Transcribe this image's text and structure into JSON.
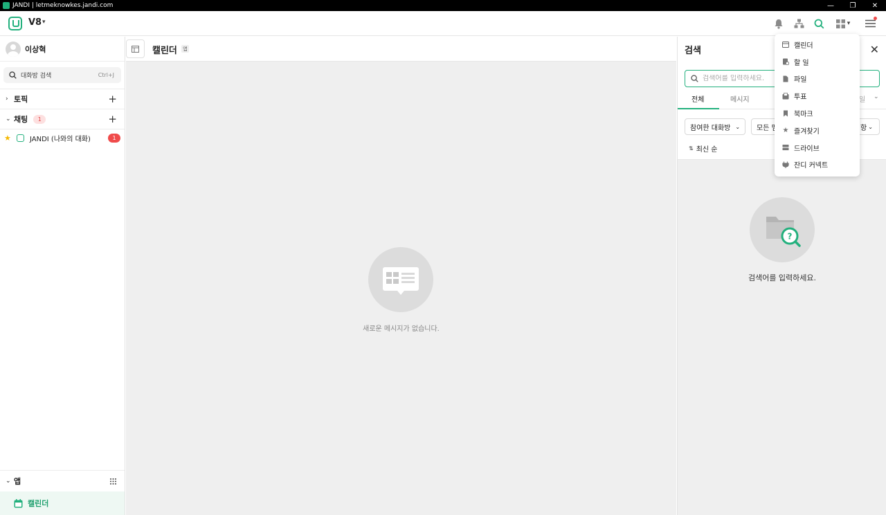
{
  "window": {
    "title": "JANDI | letmeknowkes.jandi.com",
    "controls": [
      "—",
      "❐",
      "✕"
    ]
  },
  "header": {
    "team_name": "V8",
    "caret": "⌄",
    "icons": [
      "bell-icon",
      "org-chart-icon",
      "search-icon",
      "apps-grid-icon",
      "menu-icon"
    ],
    "accent_color": "#22b07d"
  },
  "sidebar": {
    "profile_name": "이상혁",
    "search": {
      "label": "대화방 검색",
      "shortcut": "Ctrl+J"
    },
    "sections": {
      "topic": {
        "label": "토픽"
      },
      "chat": {
        "label": "채팅",
        "badge": "1"
      },
      "apps": {
        "label": "앱"
      }
    },
    "chats": [
      {
        "name": "JANDI (나와의 대화)",
        "badge": "1"
      }
    ],
    "apps_items": [
      {
        "label": "캘린더"
      }
    ]
  },
  "center": {
    "title": "캘린더",
    "tag": "앱",
    "empty_message": "새로운 메시지가 없습니다."
  },
  "search_panel": {
    "title": "검색",
    "placeholder": "검색어를 입력하세요.",
    "tabs": [
      {
        "label": "전체",
        "active": true
      },
      {
        "label": "메시지",
        "active": false
      }
    ],
    "tab_more": "일",
    "filters": [
      {
        "label": "참여한 대화방"
      },
      {
        "label": "모든 멤"
      },
      {
        "label": "항"
      }
    ],
    "sort_label": "최신 순",
    "empty_message": "검색어를 입력하세요."
  },
  "apps_dropdown": {
    "items": [
      {
        "label": "캘린더",
        "icon": "calendar-icon"
      },
      {
        "label": "할 일",
        "icon": "todo-icon"
      },
      {
        "label": "파일",
        "icon": "file-icon"
      },
      {
        "label": "투표",
        "icon": "poll-icon"
      },
      {
        "label": "북마크",
        "icon": "bookmark-icon"
      },
      {
        "label": "즐겨찾기",
        "icon": "star-icon"
      },
      {
        "label": "드라이브",
        "icon": "drive-icon"
      },
      {
        "label": "잔디 커넥트",
        "icon": "connect-icon"
      }
    ]
  }
}
